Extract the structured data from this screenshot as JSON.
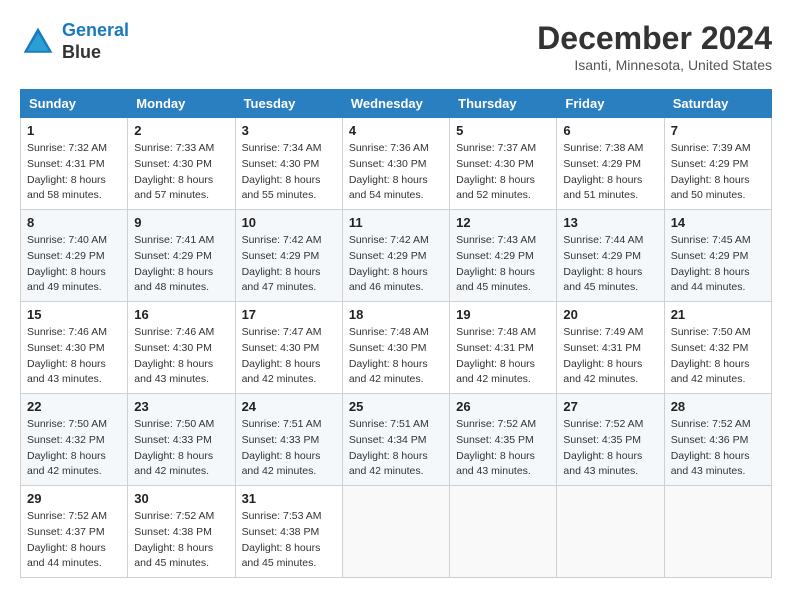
{
  "header": {
    "logo_line1": "General",
    "logo_line2": "Blue",
    "title": "December 2024",
    "location": "Isanti, Minnesota, United States"
  },
  "weekdays": [
    "Sunday",
    "Monday",
    "Tuesday",
    "Wednesday",
    "Thursday",
    "Friday",
    "Saturday"
  ],
  "weeks": [
    [
      {
        "day": "1",
        "sunrise": "7:32 AM",
        "sunset": "4:31 PM",
        "daylight": "8 hours and 58 minutes."
      },
      {
        "day": "2",
        "sunrise": "7:33 AM",
        "sunset": "4:30 PM",
        "daylight": "8 hours and 57 minutes."
      },
      {
        "day": "3",
        "sunrise": "7:34 AM",
        "sunset": "4:30 PM",
        "daylight": "8 hours and 55 minutes."
      },
      {
        "day": "4",
        "sunrise": "7:36 AM",
        "sunset": "4:30 PM",
        "daylight": "8 hours and 54 minutes."
      },
      {
        "day": "5",
        "sunrise": "7:37 AM",
        "sunset": "4:30 PM",
        "daylight": "8 hours and 52 minutes."
      },
      {
        "day": "6",
        "sunrise": "7:38 AM",
        "sunset": "4:29 PM",
        "daylight": "8 hours and 51 minutes."
      },
      {
        "day": "7",
        "sunrise": "7:39 AM",
        "sunset": "4:29 PM",
        "daylight": "8 hours and 50 minutes."
      }
    ],
    [
      {
        "day": "8",
        "sunrise": "7:40 AM",
        "sunset": "4:29 PM",
        "daylight": "8 hours and 49 minutes."
      },
      {
        "day": "9",
        "sunrise": "7:41 AM",
        "sunset": "4:29 PM",
        "daylight": "8 hours and 48 minutes."
      },
      {
        "day": "10",
        "sunrise": "7:42 AM",
        "sunset": "4:29 PM",
        "daylight": "8 hours and 47 minutes."
      },
      {
        "day": "11",
        "sunrise": "7:42 AM",
        "sunset": "4:29 PM",
        "daylight": "8 hours and 46 minutes."
      },
      {
        "day": "12",
        "sunrise": "7:43 AM",
        "sunset": "4:29 PM",
        "daylight": "8 hours and 45 minutes."
      },
      {
        "day": "13",
        "sunrise": "7:44 AM",
        "sunset": "4:29 PM",
        "daylight": "8 hours and 45 minutes."
      },
      {
        "day": "14",
        "sunrise": "7:45 AM",
        "sunset": "4:29 PM",
        "daylight": "8 hours and 44 minutes."
      }
    ],
    [
      {
        "day": "15",
        "sunrise": "7:46 AM",
        "sunset": "4:30 PM",
        "daylight": "8 hours and 43 minutes."
      },
      {
        "day": "16",
        "sunrise": "7:46 AM",
        "sunset": "4:30 PM",
        "daylight": "8 hours and 43 minutes."
      },
      {
        "day": "17",
        "sunrise": "7:47 AM",
        "sunset": "4:30 PM",
        "daylight": "8 hours and 42 minutes."
      },
      {
        "day": "18",
        "sunrise": "7:48 AM",
        "sunset": "4:30 PM",
        "daylight": "8 hours and 42 minutes."
      },
      {
        "day": "19",
        "sunrise": "7:48 AM",
        "sunset": "4:31 PM",
        "daylight": "8 hours and 42 minutes."
      },
      {
        "day": "20",
        "sunrise": "7:49 AM",
        "sunset": "4:31 PM",
        "daylight": "8 hours and 42 minutes."
      },
      {
        "day": "21",
        "sunrise": "7:50 AM",
        "sunset": "4:32 PM",
        "daylight": "8 hours and 42 minutes."
      }
    ],
    [
      {
        "day": "22",
        "sunrise": "7:50 AM",
        "sunset": "4:32 PM",
        "daylight": "8 hours and 42 minutes."
      },
      {
        "day": "23",
        "sunrise": "7:50 AM",
        "sunset": "4:33 PM",
        "daylight": "8 hours and 42 minutes."
      },
      {
        "day": "24",
        "sunrise": "7:51 AM",
        "sunset": "4:33 PM",
        "daylight": "8 hours and 42 minutes."
      },
      {
        "day": "25",
        "sunrise": "7:51 AM",
        "sunset": "4:34 PM",
        "daylight": "8 hours and 42 minutes."
      },
      {
        "day": "26",
        "sunrise": "7:52 AM",
        "sunset": "4:35 PM",
        "daylight": "8 hours and 43 minutes."
      },
      {
        "day": "27",
        "sunrise": "7:52 AM",
        "sunset": "4:35 PM",
        "daylight": "8 hours and 43 minutes."
      },
      {
        "day": "28",
        "sunrise": "7:52 AM",
        "sunset": "4:36 PM",
        "daylight": "8 hours and 43 minutes."
      }
    ],
    [
      {
        "day": "29",
        "sunrise": "7:52 AM",
        "sunset": "4:37 PM",
        "daylight": "8 hours and 44 minutes."
      },
      {
        "day": "30",
        "sunrise": "7:52 AM",
        "sunset": "4:38 PM",
        "daylight": "8 hours and 45 minutes."
      },
      {
        "day": "31",
        "sunrise": "7:53 AM",
        "sunset": "4:38 PM",
        "daylight": "8 hours and 45 minutes."
      },
      null,
      null,
      null,
      null
    ]
  ]
}
